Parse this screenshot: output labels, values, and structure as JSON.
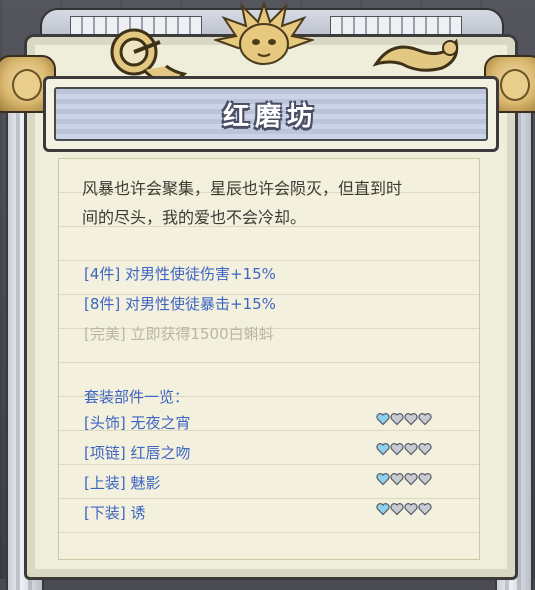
{
  "title": "红磨坊",
  "description": "风暴也许会聚集，星辰也许会陨灭，但直到时间的尽头，我的爱也不会冷却。",
  "description_lines": [
    "风暴也许会聚集，星辰也许会陨灭，但直到时",
    "间的尽头，我的爱也不会冷却。"
  ],
  "effects": [
    {
      "label": "[4件] 对男性使徒伤害+15%",
      "active": true
    },
    {
      "label": "[8件] 对男性使徒暴击+15%",
      "active": true
    },
    {
      "label": "[完美] 立即获得1500白蝌蚪",
      "active": false
    }
  ],
  "parts_title": "套装部件一览：",
  "parts": [
    {
      "label": "[头饰] 无夜之宵",
      "filled_hearts": 1,
      "total_hearts": 4
    },
    {
      "label": "[项链] 红唇之吻",
      "filled_hearts": 1,
      "total_hearts": 4
    },
    {
      "label": "[上装] 魅影",
      "filled_hearts": 1,
      "total_hearts": 4
    },
    {
      "label": "[下装] 诱",
      "filled_hearts": 1,
      "total_hearts": 4
    }
  ],
  "colors": {
    "accent_blue": "#3d66c2",
    "dim_text": "#b8b5a7",
    "heart_filled": "#8fd0ee",
    "heart_empty": "#c9cbd2",
    "panel_bg": "#efeedb"
  },
  "icons": [
    "sun-ornament-icon",
    "ring-emblem-icon",
    "scroll-ornament-icon",
    "heart-icon"
  ]
}
